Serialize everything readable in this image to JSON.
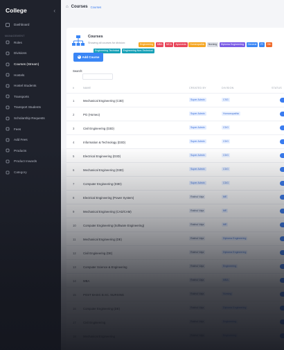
{
  "app": {
    "brand": "College"
  },
  "sidebar": {
    "section_label": "Management",
    "items": [
      {
        "label": "Dashboard",
        "icon": "dashboard-icon",
        "active": false
      },
      {
        "label": "Roles",
        "icon": "roles-icon",
        "active": false
      },
      {
        "label": "Divisions",
        "icon": "divisions-icon",
        "active": false
      },
      {
        "label": "Courses (Stream)",
        "icon": "courses-icon",
        "active": true
      },
      {
        "label": "Hostels",
        "icon": "hostel-icon",
        "active": false
      },
      {
        "label": "Hostel Students",
        "icon": "students-icon",
        "active": false
      },
      {
        "label": "Transports",
        "icon": "transport-icon",
        "active": false
      },
      {
        "label": "Transport Students",
        "icon": "transport-students-icon",
        "active": false
      },
      {
        "label": "Scholarship Requests",
        "icon": "scholarship-icon",
        "active": false
      },
      {
        "label": "Fees",
        "icon": "fees-icon",
        "active": false
      },
      {
        "label": "Add Fees",
        "icon": "add-fees-icon",
        "active": false
      },
      {
        "label": "Products",
        "icon": "products-icon",
        "active": false
      },
      {
        "label": "Product Inwards",
        "icon": "inwards-icon",
        "active": false
      },
      {
        "label": "Category",
        "icon": "category-icon",
        "active": false
      }
    ]
  },
  "topbar": {
    "title": "Courses",
    "breadcrumb": "Courses"
  },
  "card": {
    "title": "Courses",
    "subtitle": "Showing all courses for division:",
    "tags": [
      {
        "label": "Engineering",
        "color": "#f5a623"
      },
      {
        "label": "MBA",
        "color": "#e8455a"
      },
      {
        "label": "MCA",
        "color": "#e8455a"
      },
      {
        "label": "Ayurveda",
        "color": "#e8455a"
      },
      {
        "label": "Homeopathic",
        "color": "#f5a623"
      },
      {
        "label": "Nursing",
        "color": "#d9dce3"
      },
      {
        "label": "Diploma Engineering",
        "color": "#7b5ce6"
      },
      {
        "label": "General",
        "color": "#3a86f5"
      },
      {
        "label": "ITI",
        "color": "#3a86f5"
      },
      {
        "label": "Oth",
        "color": "#f06a2a"
      }
    ],
    "tags_row2": [
      {
        "label": "Engineering Technical",
        "color": "#17a2b8"
      },
      {
        "label": "Engineering Non-Technical",
        "color": "#17a2b8"
      }
    ],
    "add_button": "Add Course",
    "search_label": "Search:"
  },
  "table": {
    "headers": {
      "id": "#",
      "name": "Name",
      "created_by": "Created By",
      "division": "Division",
      "status": "Status"
    },
    "rows": [
      {
        "id": "1",
        "name": "Mechanical Engineering (C3D)",
        "created_by": "Super Admin",
        "division": "CSG"
      },
      {
        "id": "2",
        "name": "PG (Homeo)",
        "created_by": "Super Admin",
        "division": "Homoeopathic"
      },
      {
        "id": "3",
        "name": "Civil Engineering (D3D)",
        "created_by": "Super Admin",
        "division": "CDG"
      },
      {
        "id": "4",
        "name": "Information & Technology (D3D)",
        "created_by": "Super Admin",
        "division": "CDG"
      },
      {
        "id": "5",
        "name": "Electrical Engineering (D3D)",
        "created_by": "Super Admin",
        "division": "CDG"
      },
      {
        "id": "6",
        "name": "Mechanical Engineering (D3D)",
        "created_by": "Super Admin",
        "division": "CDG"
      },
      {
        "id": "7",
        "name": "Computer Engineering (D3D)",
        "created_by": "Super Admin",
        "division": "CDG"
      },
      {
        "id": "8",
        "name": "Electrical Engineering (Power System)",
        "created_by": "Rakhul Vaja",
        "division": "ME"
      },
      {
        "id": "9",
        "name": "Mechanical Engineering (CAD/CAM)",
        "created_by": "Rakhul Vaja",
        "division": "ME"
      },
      {
        "id": "10",
        "name": "Computer Engineering (Software Engineering)",
        "created_by": "Rakhul Vaja",
        "division": "ME"
      },
      {
        "id": "11",
        "name": "Mechanical Engineering (DE)",
        "created_by": "Rakhul Vaja",
        "division": "Diploma Engineering"
      },
      {
        "id": "12",
        "name": "Civil Engineering (DE)",
        "created_by": "Rakhul Vaja",
        "division": "Diploma Engineering"
      },
      {
        "id": "13",
        "name": "Computer Science & Engineering",
        "created_by": "Rakhul Vaja",
        "division": "Engineering"
      },
      {
        "id": "14",
        "name": "MBA",
        "created_by": "Rakhul Vaja",
        "division": "MBA"
      },
      {
        "id": "15",
        "name": "POST BASIC B.SC. NURSING",
        "created_by": "Rakhul Vaja",
        "division": "Nursing"
      },
      {
        "id": "16",
        "name": "Computer Engineering (DE)",
        "created_by": "Rakhul Vaja",
        "division": "Diploma Engineering"
      },
      {
        "id": "17",
        "name": "Civil Engineering",
        "created_by": "Rakhul Vaja",
        "division": "Engineering"
      },
      {
        "id": "18",
        "name": "Mechanical Engineering",
        "created_by": "Rakhul Vaja",
        "division": "Engineering"
      }
    ]
  }
}
